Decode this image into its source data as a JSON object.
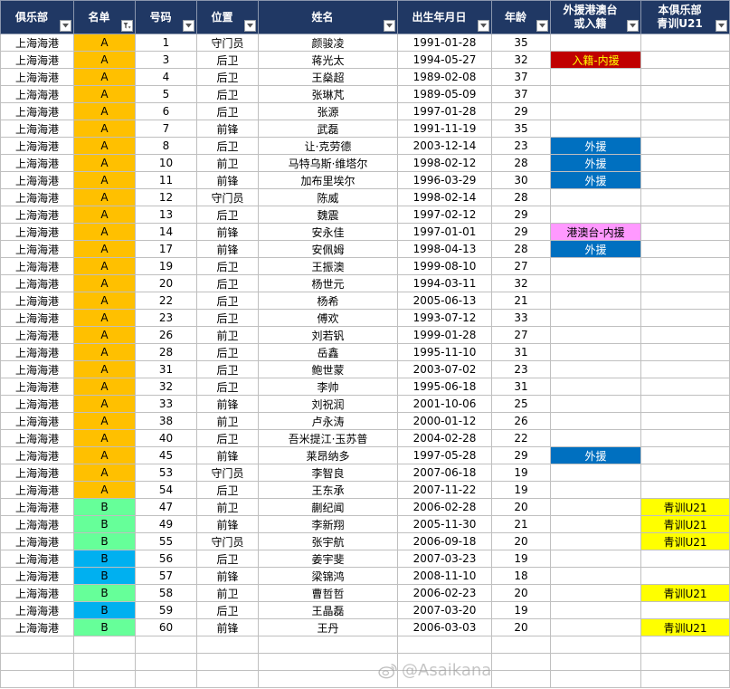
{
  "headers": [
    {
      "label": "俱乐部",
      "filter": "dropdown"
    },
    {
      "label": "名单",
      "filter": "active"
    },
    {
      "label": "号码",
      "filter": "dropdown"
    },
    {
      "label": "位置",
      "filter": "dropdown"
    },
    {
      "label": "姓名",
      "filter": "dropdown"
    },
    {
      "label": "出生年月日",
      "filter": "dropdown"
    },
    {
      "label": "年龄",
      "filter": "dropdown"
    },
    {
      "label": "外援港澳台\n或入籍",
      "filter": "dropdown"
    },
    {
      "label": "本俱乐部\n青训U21",
      "filter": "dropdown"
    }
  ],
  "colors": {
    "header_bg": "#203864",
    "list_A": "#FFC000",
    "list_B_green": "#66FF99",
    "list_B_blue": "#00B0F0",
    "foreign": "#0070C0",
    "naturalized": "#C00000",
    "naturalized_text": "#FFFF00",
    "hmt": "#FF99FF",
    "youth": "#FFFF00"
  },
  "rows": [
    {
      "club": "上海海港",
      "list": "A",
      "list_color": "A",
      "num": "1",
      "pos": "守门员",
      "name": "颜骏凌",
      "dob": "1991-01-28",
      "age": "35",
      "flag": "",
      "flag_type": "",
      "youth": ""
    },
    {
      "club": "上海海港",
      "list": "A",
      "list_color": "A",
      "num": "3",
      "pos": "后卫",
      "name": "蒋光太",
      "dob": "1994-05-27",
      "age": "32",
      "flag": "入籍-内援",
      "flag_type": "naturalized",
      "youth": ""
    },
    {
      "club": "上海海港",
      "list": "A",
      "list_color": "A",
      "num": "4",
      "pos": "后卫",
      "name": "王燊超",
      "dob": "1989-02-08",
      "age": "37",
      "flag": "",
      "flag_type": "",
      "youth": ""
    },
    {
      "club": "上海海港",
      "list": "A",
      "list_color": "A",
      "num": "5",
      "pos": "后卫",
      "name": "张琳芃",
      "dob": "1989-05-09",
      "age": "37",
      "flag": "",
      "flag_type": "",
      "youth": ""
    },
    {
      "club": "上海海港",
      "list": "A",
      "list_color": "A",
      "num": "6",
      "pos": "后卫",
      "name": "张源",
      "dob": "1997-01-28",
      "age": "29",
      "flag": "",
      "flag_type": "",
      "youth": ""
    },
    {
      "club": "上海海港",
      "list": "A",
      "list_color": "A",
      "num": "7",
      "pos": "前锋",
      "name": "武磊",
      "dob": "1991-11-19",
      "age": "35",
      "flag": "",
      "flag_type": "",
      "youth": ""
    },
    {
      "club": "上海海港",
      "list": "A",
      "list_color": "A",
      "num": "8",
      "pos": "后卫",
      "name": "让·克劳德",
      "dob": "2003-12-14",
      "age": "23",
      "flag": "外援",
      "flag_type": "foreign",
      "youth": ""
    },
    {
      "club": "上海海港",
      "list": "A",
      "list_color": "A",
      "num": "10",
      "pos": "前卫",
      "name": "马特乌斯·维塔尔",
      "dob": "1998-02-12",
      "age": "28",
      "flag": "外援",
      "flag_type": "foreign",
      "youth": ""
    },
    {
      "club": "上海海港",
      "list": "A",
      "list_color": "A",
      "num": "11",
      "pos": "前锋",
      "name": "加布里埃尔",
      "dob": "1996-03-29",
      "age": "30",
      "flag": "外援",
      "flag_type": "foreign",
      "youth": ""
    },
    {
      "club": "上海海港",
      "list": "A",
      "list_color": "A",
      "num": "12",
      "pos": "守门员",
      "name": "陈威",
      "dob": "1998-02-14",
      "age": "28",
      "flag": "",
      "flag_type": "",
      "youth": ""
    },
    {
      "club": "上海海港",
      "list": "A",
      "list_color": "A",
      "num": "13",
      "pos": "后卫",
      "name": "魏震",
      "dob": "1997-02-12",
      "age": "29",
      "flag": "",
      "flag_type": "",
      "youth": ""
    },
    {
      "club": "上海海港",
      "list": "A",
      "list_color": "A",
      "num": "14",
      "pos": "前锋",
      "name": "安永佳",
      "dob": "1997-01-01",
      "age": "29",
      "flag": "港澳台-内援",
      "flag_type": "hmt",
      "youth": ""
    },
    {
      "club": "上海海港",
      "list": "A",
      "list_color": "A",
      "num": "17",
      "pos": "前锋",
      "name": "安佩姆",
      "dob": "1998-04-13",
      "age": "28",
      "flag": "外援",
      "flag_type": "foreign",
      "youth": ""
    },
    {
      "club": "上海海港",
      "list": "A",
      "list_color": "A",
      "num": "19",
      "pos": "后卫",
      "name": "王振澳",
      "dob": "1999-08-10",
      "age": "27",
      "flag": "",
      "flag_type": "",
      "youth": ""
    },
    {
      "club": "上海海港",
      "list": "A",
      "list_color": "A",
      "num": "20",
      "pos": "后卫",
      "name": "杨世元",
      "dob": "1994-03-11",
      "age": "32",
      "flag": "",
      "flag_type": "",
      "youth": ""
    },
    {
      "club": "上海海港",
      "list": "A",
      "list_color": "A",
      "num": "22",
      "pos": "后卫",
      "name": "杨希",
      "dob": "2005-06-13",
      "age": "21",
      "flag": "",
      "flag_type": "",
      "youth": ""
    },
    {
      "club": "上海海港",
      "list": "A",
      "list_color": "A",
      "num": "23",
      "pos": "后卫",
      "name": "傅欢",
      "dob": "1993-07-12",
      "age": "33",
      "flag": "",
      "flag_type": "",
      "youth": ""
    },
    {
      "club": "上海海港",
      "list": "A",
      "list_color": "A",
      "num": "26",
      "pos": "前卫",
      "name": "刘若钒",
      "dob": "1999-01-28",
      "age": "27",
      "flag": "",
      "flag_type": "",
      "youth": ""
    },
    {
      "club": "上海海港",
      "list": "A",
      "list_color": "A",
      "num": "28",
      "pos": "后卫",
      "name": "岳鑫",
      "dob": "1995-11-10",
      "age": "31",
      "flag": "",
      "flag_type": "",
      "youth": ""
    },
    {
      "club": "上海海港",
      "list": "A",
      "list_color": "A",
      "num": "31",
      "pos": "后卫",
      "name": "鲍世蒙",
      "dob": "2003-07-02",
      "age": "23",
      "flag": "",
      "flag_type": "",
      "youth": ""
    },
    {
      "club": "上海海港",
      "list": "A",
      "list_color": "A",
      "num": "32",
      "pos": "后卫",
      "name": "李帅",
      "dob": "1995-06-18",
      "age": "31",
      "flag": "",
      "flag_type": "",
      "youth": ""
    },
    {
      "club": "上海海港",
      "list": "A",
      "list_color": "A",
      "num": "33",
      "pos": "前锋",
      "name": "刘祝润",
      "dob": "2001-10-06",
      "age": "25",
      "flag": "",
      "flag_type": "",
      "youth": ""
    },
    {
      "club": "上海海港",
      "list": "A",
      "list_color": "A",
      "num": "38",
      "pos": "前卫",
      "name": "卢永涛",
      "dob": "2000-01-12",
      "age": "26",
      "flag": "",
      "flag_type": "",
      "youth": ""
    },
    {
      "club": "上海海港",
      "list": "A",
      "list_color": "A",
      "num": "40",
      "pos": "后卫",
      "name": "吾米提江·玉苏普",
      "dob": "2004-02-28",
      "age": "22",
      "flag": "",
      "flag_type": "",
      "youth": ""
    },
    {
      "club": "上海海港",
      "list": "A",
      "list_color": "A",
      "num": "45",
      "pos": "前锋",
      "name": "莱昂纳多",
      "dob": "1997-05-28",
      "age": "29",
      "flag": "外援",
      "flag_type": "foreign",
      "youth": ""
    },
    {
      "club": "上海海港",
      "list": "A",
      "list_color": "A",
      "num": "53",
      "pos": "守门员",
      "name": "李智良",
      "dob": "2007-06-18",
      "age": "19",
      "flag": "",
      "flag_type": "",
      "youth": ""
    },
    {
      "club": "上海海港",
      "list": "A",
      "list_color": "A",
      "num": "54",
      "pos": "后卫",
      "name": "王东承",
      "dob": "2007-11-22",
      "age": "19",
      "flag": "",
      "flag_type": "",
      "youth": ""
    },
    {
      "club": "上海海港",
      "list": "B",
      "list_color": "B_green",
      "num": "47",
      "pos": "前卫",
      "name": "蒯纪闻",
      "dob": "2006-02-28",
      "age": "20",
      "flag": "",
      "flag_type": "",
      "youth": "青训U21"
    },
    {
      "club": "上海海港",
      "list": "B",
      "list_color": "B_green",
      "num": "49",
      "pos": "前锋",
      "name": "李新翔",
      "dob": "2005-11-30",
      "age": "21",
      "flag": "",
      "flag_type": "",
      "youth": "青训U21"
    },
    {
      "club": "上海海港",
      "list": "B",
      "list_color": "B_green",
      "num": "55",
      "pos": "守门员",
      "name": "张宇航",
      "dob": "2006-09-18",
      "age": "20",
      "flag": "",
      "flag_type": "",
      "youth": "青训U21"
    },
    {
      "club": "上海海港",
      "list": "B",
      "list_color": "B_blue",
      "num": "56",
      "pos": "后卫",
      "name": "姜宇斐",
      "dob": "2007-03-23",
      "age": "19",
      "flag": "",
      "flag_type": "",
      "youth": ""
    },
    {
      "club": "上海海港",
      "list": "B",
      "list_color": "B_blue",
      "num": "57",
      "pos": "前锋",
      "name": "梁锦鸿",
      "dob": "2008-11-10",
      "age": "18",
      "flag": "",
      "flag_type": "",
      "youth": ""
    },
    {
      "club": "上海海港",
      "list": "B",
      "list_color": "B_green",
      "num": "58",
      "pos": "前卫",
      "name": "曹哲哲",
      "dob": "2006-02-23",
      "age": "20",
      "flag": "",
      "flag_type": "",
      "youth": "青训U21"
    },
    {
      "club": "上海海港",
      "list": "B",
      "list_color": "B_blue",
      "num": "59",
      "pos": "后卫",
      "name": "王晶磊",
      "dob": "2007-03-20",
      "age": "19",
      "flag": "",
      "flag_type": "",
      "youth": ""
    },
    {
      "club": "上海海港",
      "list": "B",
      "list_color": "B_green",
      "num": "60",
      "pos": "前锋",
      "name": "王丹",
      "dob": "2006-03-03",
      "age": "20",
      "flag": "",
      "flag_type": "",
      "youth": "青训U21"
    }
  ],
  "empty_rows": 3,
  "watermark": "@Asaikana"
}
